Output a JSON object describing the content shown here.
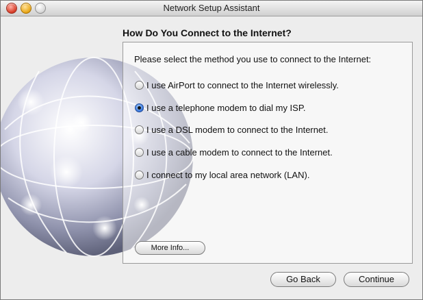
{
  "window": {
    "title": "Network Setup Assistant",
    "controls": [
      "close-icon",
      "minimize-icon",
      "zoom-icon"
    ]
  },
  "header": {
    "title": "How Do You Connect to the Internet?"
  },
  "panel": {
    "prompt": "Please select the method you use to connect to the Internet:",
    "options": [
      {
        "label": "I use AirPort to connect to the Internet wirelessly.",
        "selected": false
      },
      {
        "label": "I use a telephone modem to dial my ISP.",
        "selected": true
      },
      {
        "label": "I use a DSL modem to connect to the Internet.",
        "selected": false
      },
      {
        "label": "I use a cable modem to connect to the Internet.",
        "selected": false
      },
      {
        "label": "I connect to my local area network (LAN).",
        "selected": false
      }
    ],
    "more_info_label": "More Info..."
  },
  "footer": {
    "go_back_label": "Go Back",
    "continue_label": "Continue"
  },
  "colors": {
    "selected_radio": "#3f7de0",
    "window_background": "#ededed"
  }
}
